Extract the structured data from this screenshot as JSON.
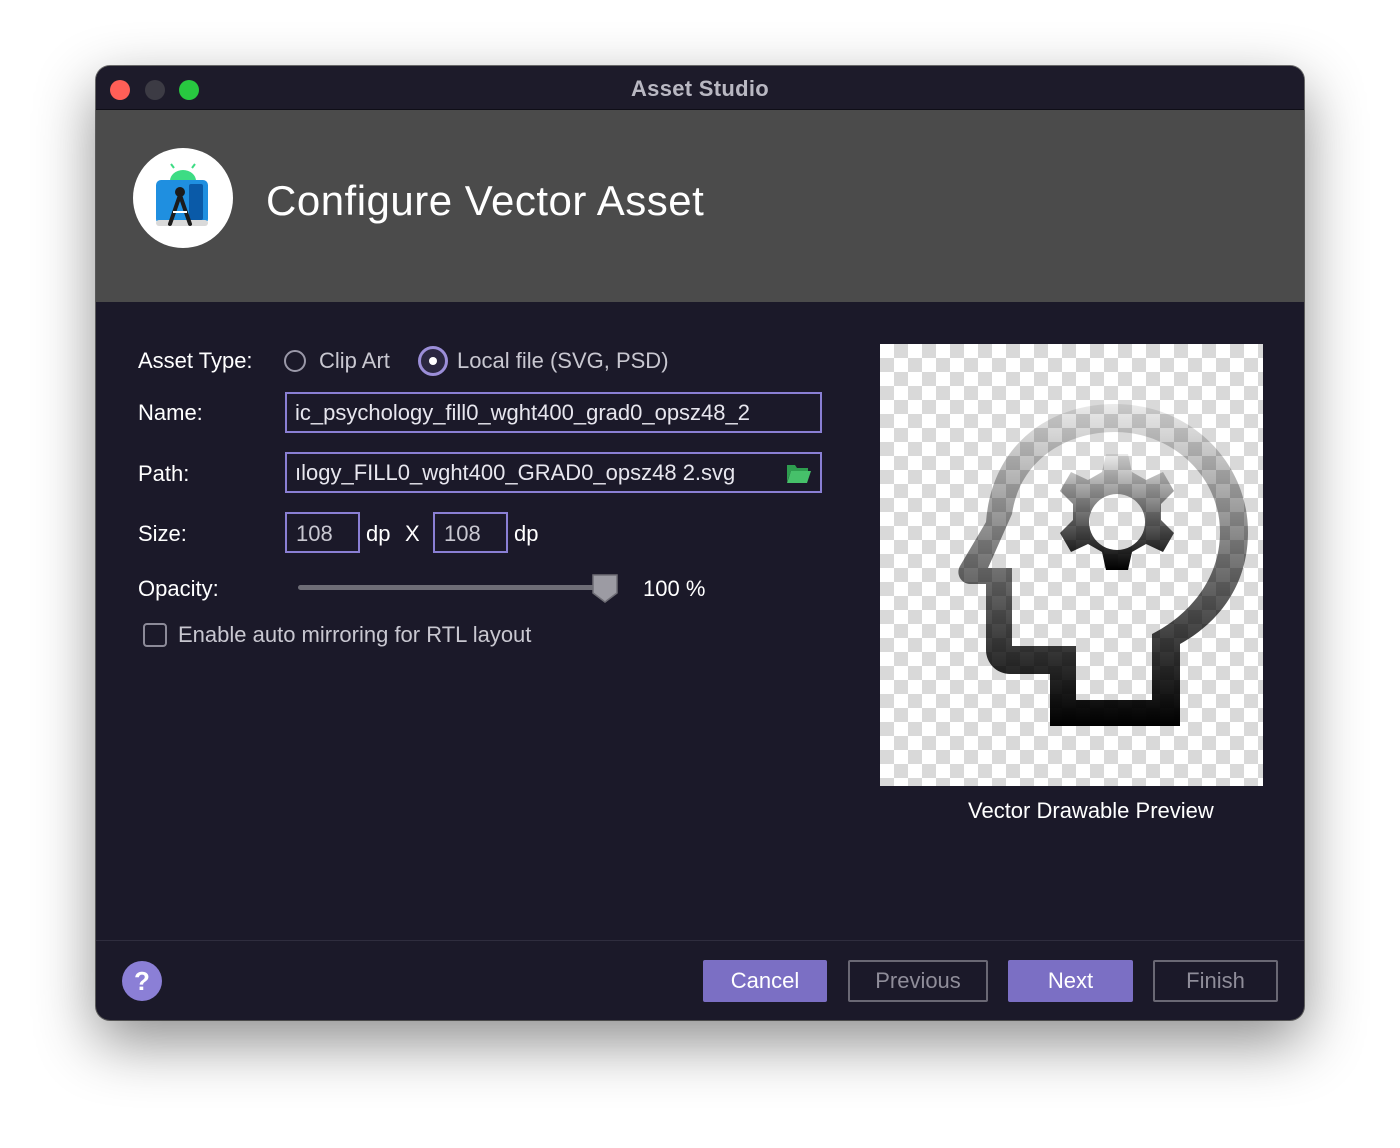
{
  "window": {
    "title": "Asset Studio",
    "traffic_lights": [
      "close",
      "minimize",
      "zoom"
    ]
  },
  "header": {
    "title": "Configure Vector Asset",
    "logo_icon": "android-studio-logo-icon"
  },
  "form": {
    "asset_type_label": "Asset Type:",
    "asset_type_options": [
      {
        "label": "Clip Art",
        "selected": false
      },
      {
        "label": "Local file (SVG, PSD)",
        "selected": true
      }
    ],
    "name_label": "Name:",
    "name_value": "ic_psychology_fill0_wght400_grad0_opsz48_2",
    "path_label": "Path:",
    "path_value": "ılogy_FILL0_wght400_GRAD0_opsz48 2.svg",
    "path_icon": "folder-open-icon",
    "size_label": "Size:",
    "width_value": "108",
    "height_value": "108",
    "unit_dp": "dp",
    "size_separator": "X",
    "opacity_label": "Opacity:",
    "opacity_value": "100 %",
    "opacity_fraction": 1.0,
    "mirroring_label": "Enable auto mirroring for RTL layout",
    "mirroring_checked": false
  },
  "preview": {
    "caption": "Vector Drawable Preview",
    "icon": "psychology-head-gear-icon"
  },
  "footer": {
    "help_label": "?",
    "cancel_label": "Cancel",
    "previous_label": "Previous",
    "next_label": "Next",
    "finish_label": "Finish"
  },
  "colors": {
    "background": "#1b1929",
    "header": "#4b4b4b",
    "accent": "#7b6fc4",
    "field_border": "#8a7fd4"
  }
}
